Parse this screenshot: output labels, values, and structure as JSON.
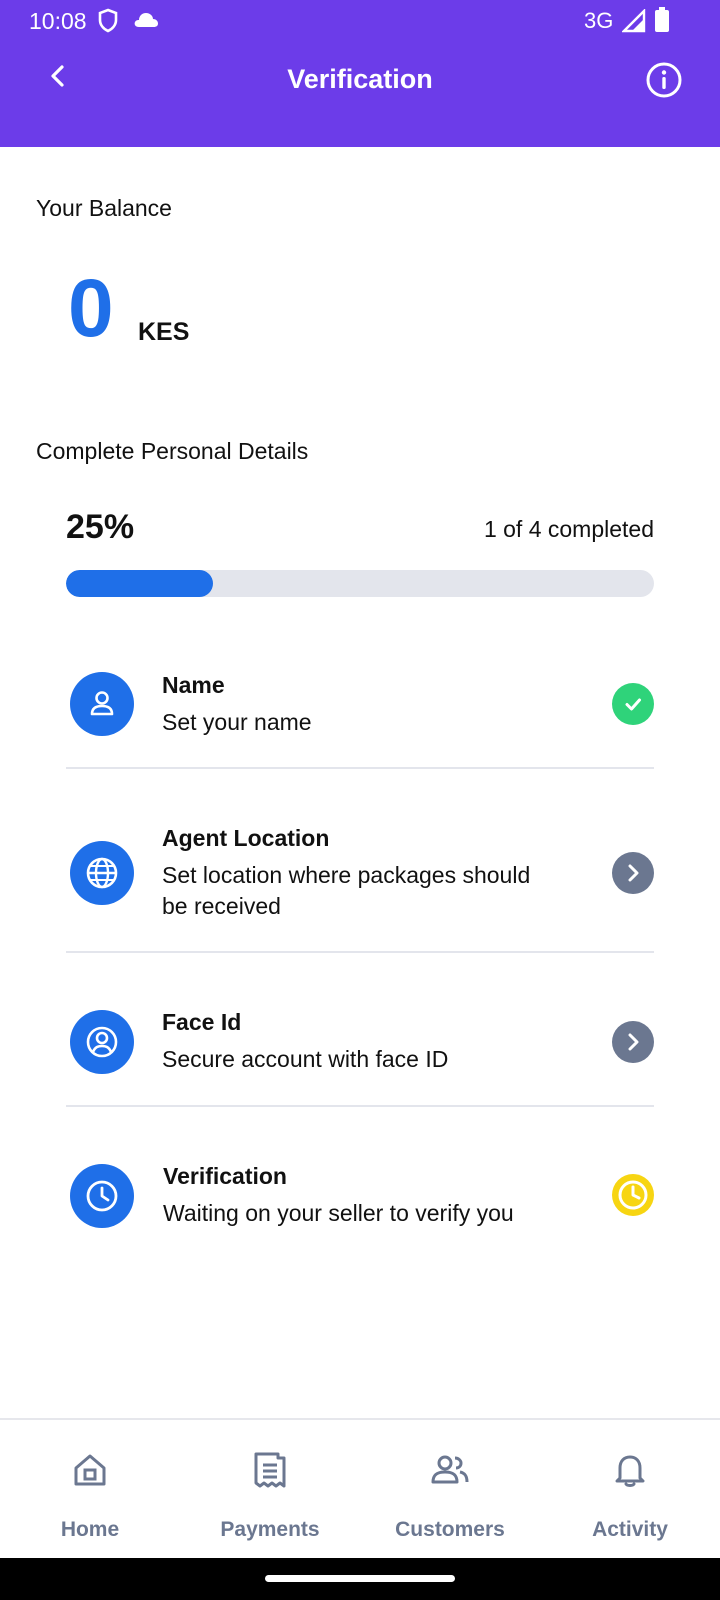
{
  "status_bar": {
    "time": "10:08",
    "network": "3G",
    "icons": [
      "shield-icon",
      "cloud-icon",
      "signal-icon",
      "battery-icon"
    ]
  },
  "app_bar": {
    "title": "Verification",
    "back_icon": "chevron-left-icon",
    "info_icon": "info-icon"
  },
  "balance": {
    "label": "Your Balance",
    "amount": "0",
    "currency": "KES"
  },
  "personal_details": {
    "title": "Complete Personal Details",
    "percent_label": "25%",
    "progress": 0.25,
    "count_label": "1 of 4 completed"
  },
  "steps": [
    {
      "title": "Name",
      "description": "Set your name",
      "icon": "user-icon",
      "status": "completed"
    },
    {
      "title": "Agent Location",
      "description": "Set location where packages should be received",
      "icon": "globe-icon",
      "status": "action"
    },
    {
      "title": "Face Id",
      "description": "Secure account with face ID",
      "icon": "face-id-icon",
      "status": "action"
    },
    {
      "title": "Verification",
      "description": "Waiting on your seller to verify you",
      "icon": "clock-icon",
      "status": "pending"
    }
  ],
  "bottom_nav": [
    {
      "label": "Home",
      "icon": "home-icon"
    },
    {
      "label": "Payments",
      "icon": "receipt-icon"
    },
    {
      "label": "Customers",
      "icon": "users-icon"
    },
    {
      "label": "Activity",
      "icon": "bell-icon"
    }
  ],
  "colors": {
    "brand_purple": "#6c3ce9",
    "accent_blue": "#1f6fe8",
    "success_green": "#2fd37a",
    "pending_yellow": "#f7d512",
    "chevron_gray": "#6b7790",
    "nav_gray": "#6b7790"
  }
}
